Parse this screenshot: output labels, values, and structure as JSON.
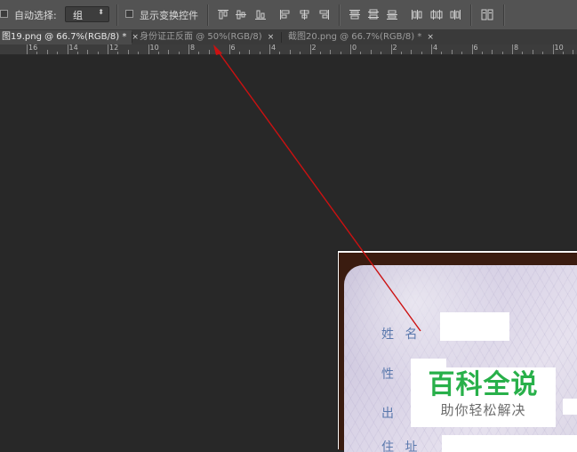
{
  "options_bar": {
    "auto_select_label": "自动选择:",
    "auto_select_value": "组",
    "show_transform_label": "显示变换控件"
  },
  "tabs": [
    {
      "label": "图19.png @ 66.7%(RGB/8) *",
      "close": "×",
      "active": true
    },
    {
      "label": "身份证正反面 @ 50%(RGB/8)",
      "close": "×",
      "active": false
    },
    {
      "label": "截图20.png @ 66.7%(RGB/8) *",
      "close": "×",
      "active": false
    }
  ],
  "ruler": {
    "labels": [
      "16",
      "14",
      "12",
      "10",
      "8",
      "6",
      "4",
      "2",
      "0",
      "2",
      "4",
      "6",
      "8",
      "10"
    ]
  },
  "card": {
    "label_name": "姓 名",
    "label_sex": "性",
    "label_birth": "出",
    "label_addr": "住 址"
  },
  "watermark": {
    "title": "百科全说",
    "subtitle": "助你轻松解决"
  },
  "colors": {
    "annotation_arrow": "#cc1111",
    "watermark_green": "#28b04a"
  }
}
